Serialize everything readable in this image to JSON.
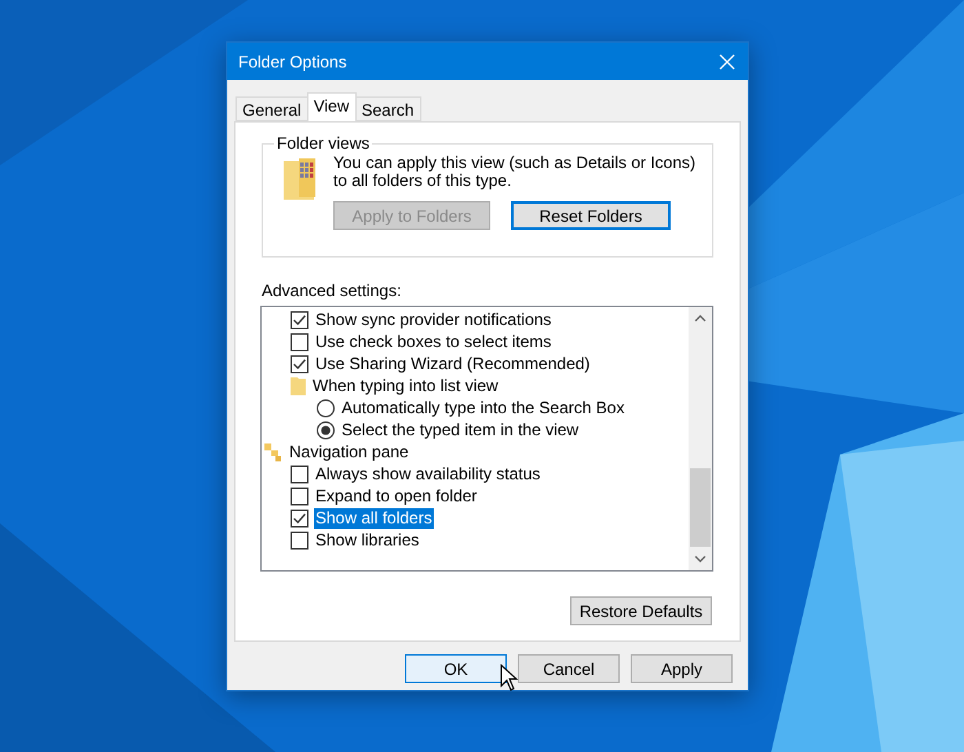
{
  "window": {
    "title": "Folder Options"
  },
  "tabs": [
    {
      "label": "General",
      "selected": false
    },
    {
      "label": "View",
      "selected": true
    },
    {
      "label": "Search",
      "selected": false
    }
  ],
  "folder_views": {
    "legend": "Folder views",
    "description": "You can apply this view (such as Details or Icons) to all folders of this type.",
    "buttons": [
      {
        "label": "Apply to Folders",
        "disabled": true,
        "focused": false
      },
      {
        "label": "Reset Folders",
        "disabled": false,
        "focused": true
      }
    ]
  },
  "advanced_settings": {
    "label": "Advanced settings:",
    "items": [
      {
        "children": [
          {
            "kind": "checkbox",
            "label": "Show sync provider notifications",
            "checked": true,
            "selected": false
          },
          {
            "kind": "checkbox",
            "label": "Use check boxes to select items",
            "checked": false,
            "selected": false
          },
          {
            "kind": "checkbox",
            "label": "Use Sharing Wizard (Recommended)",
            "checked": true,
            "selected": false
          },
          {
            "kind": "folder",
            "label": "When typing into list view",
            "selected": false,
            "children": [
              {
                "kind": "radio",
                "label": "Automatically type into the Search Box",
                "checked": false,
                "selected": false
              },
              {
                "kind": "radio",
                "label": "Select the typed item in the view",
                "checked": true,
                "selected": false
              }
            ]
          }
        ]
      },
      {
        "kind": "group",
        "label": "Navigation pane",
        "selected": false,
        "children": [
          {
            "kind": "checkbox",
            "label": "Always show availability status",
            "checked": false,
            "selected": false
          },
          {
            "kind": "checkbox",
            "label": "Expand to open folder",
            "checked": false,
            "selected": false
          },
          {
            "kind": "checkbox",
            "label": "Show all folders",
            "checked": true,
            "selected": true
          },
          {
            "kind": "checkbox",
            "label": "Show libraries",
            "checked": false,
            "selected": false
          }
        ]
      }
    ]
  },
  "restore_button": "Restore Defaults",
  "dialog_buttons": [
    {
      "label": "OK",
      "focused": true
    },
    {
      "label": "Cancel",
      "focused": false
    },
    {
      "label": "Apply",
      "focused": false
    }
  ]
}
